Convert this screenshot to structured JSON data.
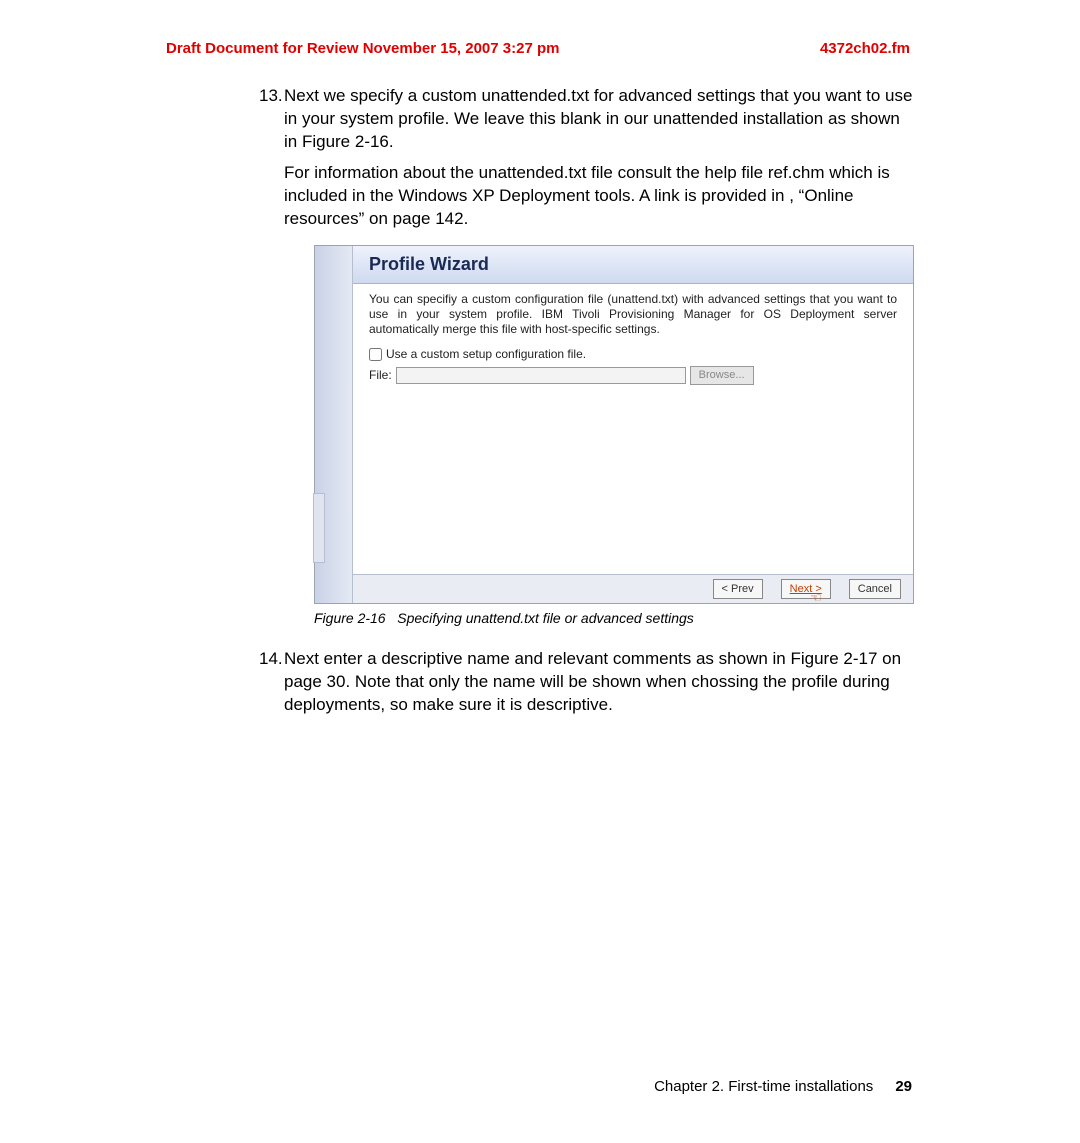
{
  "header": {
    "draft": "Draft Document for Review November 15, 2007 3:27 pm",
    "file": "4372ch02.fm"
  },
  "steps": {
    "s13": {
      "num": "13.",
      "p1": "Next we specify a custom unattended.txt for advanced settings that you want to use in your system profile. We leave this blank in our unattended installation as shown in Figure 2-16.",
      "p2": "For information about the unattended.txt file consult the help file ref.chm which is included in the Windows XP Deployment tools. A link is provided in , “Online resources” on page 142."
    },
    "s14": {
      "num": "14.",
      "p1": "Next enter a descriptive name and relevant comments as shown in Figure 2-17 on page 30. Note that only the name will be shown when chossing the profile during deployments, so make sure it is descriptive."
    }
  },
  "wizard": {
    "title": "Profile Wizard",
    "desc": "You can specifiy a custom configuration file (unattend.txt) with advanced settings that you want to use in your system profile. IBM Tivoli Provisioning Manager for OS Deployment server automatically merge this file with host-specific settings.",
    "checkbox_label": "Use a custom setup configuration file.",
    "file_label": "File:",
    "file_value": "",
    "browse": "Browse...",
    "prev": "< Prev",
    "next": "Next >",
    "cancel": "Cancel"
  },
  "figure_caption": "Figure 2-16   Specifying unattend.txt file or advanced settings",
  "footer": {
    "chapter": "Chapter 2. First-time installations",
    "page": "29"
  }
}
